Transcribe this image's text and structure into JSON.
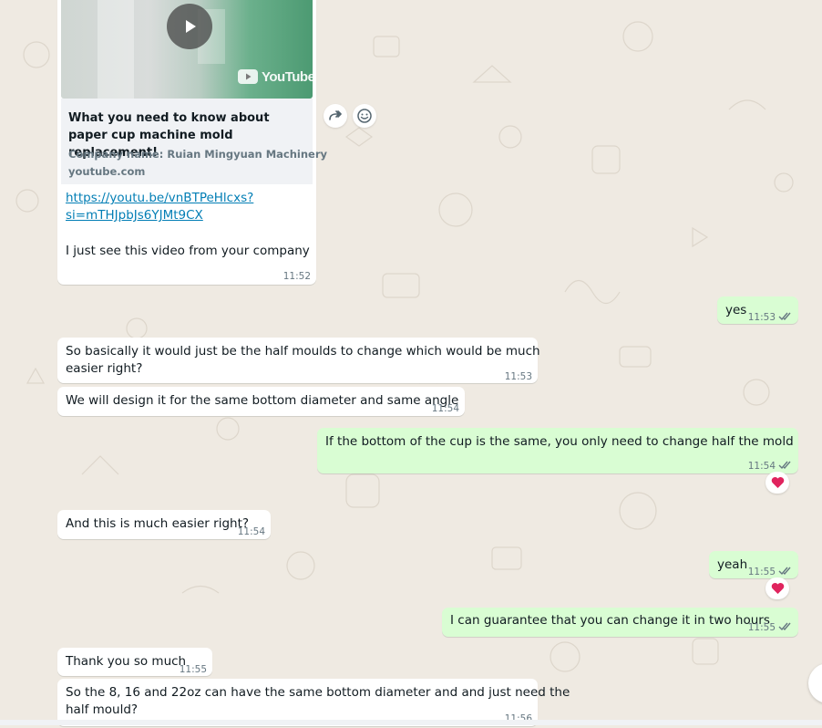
{
  "chat": {
    "link_preview": {
      "source_logo": "YouTube",
      "title": "What you need to know about paper cup machine mold replacement!",
      "description": "Company name: Ruian Mingyuan Machinery",
      "domain": "youtube.com",
      "url_line1": "https://youtu.be/vnBTPeHlcxs?",
      "url_line2": "si=mTHJpbJs6YJMt9CX",
      "text": "I just see this video from your company",
      "time": "11:52"
    },
    "messages": [
      {
        "dir": "out",
        "text": "yes",
        "time": "11:53"
      },
      {
        "dir": "in",
        "line1": "So basically it would just be the half moulds to change which would be much",
        "line2": "easier right?",
        "time": "11:53"
      },
      {
        "dir": "in",
        "text": "We will design it for the same bottom diameter and same angle",
        "time": "11:54"
      },
      {
        "dir": "out",
        "text": "If the bottom of the cup is the same, you only need to change half the mold",
        "time": "11:54"
      },
      {
        "dir": "in",
        "text": "And this is much easier right?",
        "time": "11:54"
      },
      {
        "dir": "out",
        "text": "yeah",
        "time": "11:55"
      },
      {
        "dir": "out",
        "text": "I can guarantee that you can change it in two hours",
        "time": "11:55"
      },
      {
        "dir": "in",
        "text": "Thank you so much",
        "time": "11:55"
      },
      {
        "dir": "in",
        "line1": "So the 8, 16 and 22oz can have the same bottom diameter and and just need the",
        "line2": "half mould?",
        "time": "11:56"
      }
    ]
  },
  "icons": {
    "play": "play-icon",
    "forward": "forward-icon",
    "emoji": "emoji-icon",
    "read_receipt": "double-check-icon",
    "reaction": "red-heart-emoji"
  },
  "colors": {
    "incoming_bubble": "#ffffff",
    "outgoing_bubble": "#d9fdd3",
    "link": "#027eb5",
    "read_ticks": "#53bdeb",
    "heart": "#e0245e"
  }
}
